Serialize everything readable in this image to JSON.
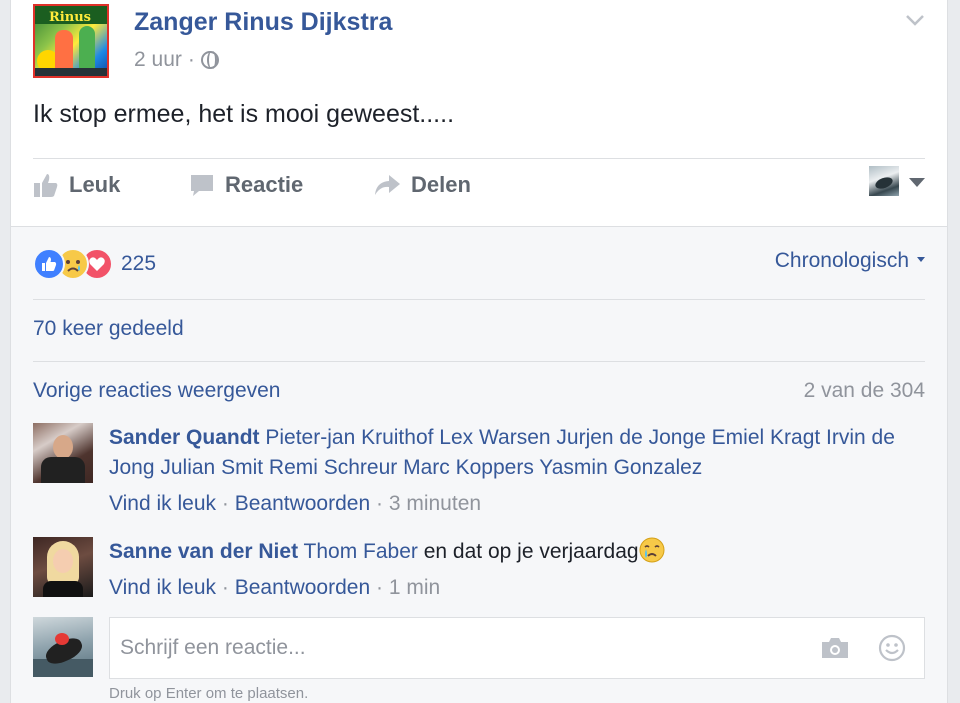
{
  "post": {
    "page_name": "Zanger Rinus Dijkstra",
    "avatar_text": "Rinus",
    "time": "2 uur",
    "meta_sep": "·",
    "text": "Ik stop ermee, het is mooi geweest....."
  },
  "actions": {
    "like": "Leuk",
    "comment": "Reactie",
    "share": "Delen"
  },
  "reactions": {
    "types": [
      "like",
      "sad",
      "love"
    ],
    "count": "225",
    "sort_label": "Chronologisch"
  },
  "shares": "70 keer gedeeld",
  "comments_header": {
    "previous_link": "Vorige reacties weergeven",
    "count": "2 van de 304"
  },
  "comments": [
    {
      "author": "Sander Quandt",
      "tags": "Pieter-jan Kruithof Lex Warsen Jurjen de Jonge Emiel Kragt Irvin de Jong Julian Smit Remi Schreur Marc Koppers Yasmin Gonzalez",
      "text": "",
      "like": "Vind ik leuk",
      "reply": "Beantwoorden",
      "sep": "·",
      "time": "3 minuten"
    },
    {
      "author": "Sanne van der Niet",
      "tags": "Thom Faber",
      "text": " en dat op je verjaardag",
      "emoji": "crying-emoji",
      "like": "Vind ik leuk",
      "reply": "Beantwoorden",
      "sep": "·",
      "time": "1 min"
    }
  ],
  "compose": {
    "placeholder": "Schrijf een reactie...",
    "hint": "Druk op Enter om te plaatsen."
  },
  "colors": {
    "link": "#365899",
    "muted": "#90949c",
    "like_blue": "#4080ff",
    "love_red": "#f25268",
    "sad_yellow": "#f7c948"
  }
}
